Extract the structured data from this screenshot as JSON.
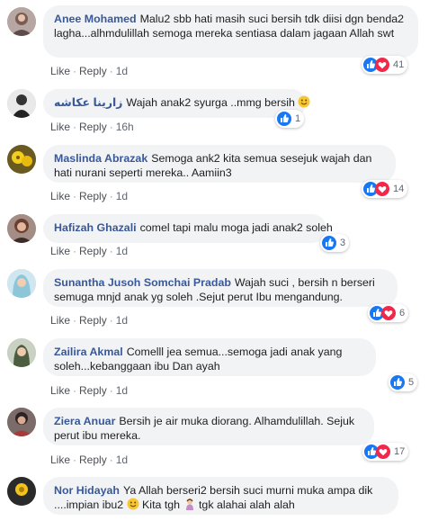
{
  "actions": {
    "like": "Like",
    "reply": "Reply",
    "sep": "·"
  },
  "colors": {
    "author": "#385898",
    "bubble": "#f2f3f5",
    "like_blue": "#1877f2",
    "love_red": "#f0284a"
  },
  "comments": [
    {
      "author": "Anee Mohamed",
      "text": "Malu2 sbb hati masih suci bersih tdk diisi dgn benda2 lagha...alhmdulillah semoga mereka sentiasa dalam jagaan Allah swt",
      "time": "1d",
      "reactions": [
        "like-icon",
        "love-icon"
      ],
      "count": "41"
    },
    {
      "author": "زارينا عكاشه",
      "text": "Wajah anak2 syurga ..mmg bersih",
      "emoji": "smile-emoji",
      "time": "16h",
      "reactions": [
        "like-icon"
      ],
      "count": "1"
    },
    {
      "author": "Maslinda Abrazak",
      "text": "Semoga ank2 kita semua sesejuk wajah dan hati nurani seperti mereka.. Aamiin3",
      "time": "1d",
      "reactions": [
        "like-icon",
        "love-icon"
      ],
      "count": "14"
    },
    {
      "author": "Hafizah Ghazali",
      "text": "comel tapi malu moga jadi anak2 soleh",
      "time": "1d",
      "reactions": [
        "like-icon"
      ],
      "count": "3"
    },
    {
      "author": "Sunantha Jusoh Somchai Pradab",
      "text": "Wajah suci , bersih n berseri semuga mnjd anak yg soleh .Sejut perut Ibu mengandung.",
      "time": "1d",
      "reactions": [
        "like-icon",
        "love-icon"
      ],
      "count": "6"
    },
    {
      "author": "Zailira Akmal",
      "text": "Comelll jea semua...semoga jadi anak yang soleh...kebanggaan ibu Dan ayah",
      "time": "1d",
      "reactions": [
        "like-icon"
      ],
      "count": "5"
    },
    {
      "author": "Ziera Anuar",
      "text": "Bersih je air muka diorang. Alhamdulillah. Sejuk perut ibu mereka.",
      "time": "1d",
      "reactions": [
        "like-icon",
        "love-icon"
      ],
      "count": "17"
    },
    {
      "author": "Nor Hidayah",
      "text": "Ya Allah berseri2 bersih suci murni muka ampa dik ....impian ibu2",
      "emoji": "smile-emoji",
      "text_after": "Kita tgh",
      "emoji2": "woman-emoji",
      "text_after2": "tgk alahai alah alah",
      "time": "",
      "reactions": [],
      "count": ""
    }
  ]
}
